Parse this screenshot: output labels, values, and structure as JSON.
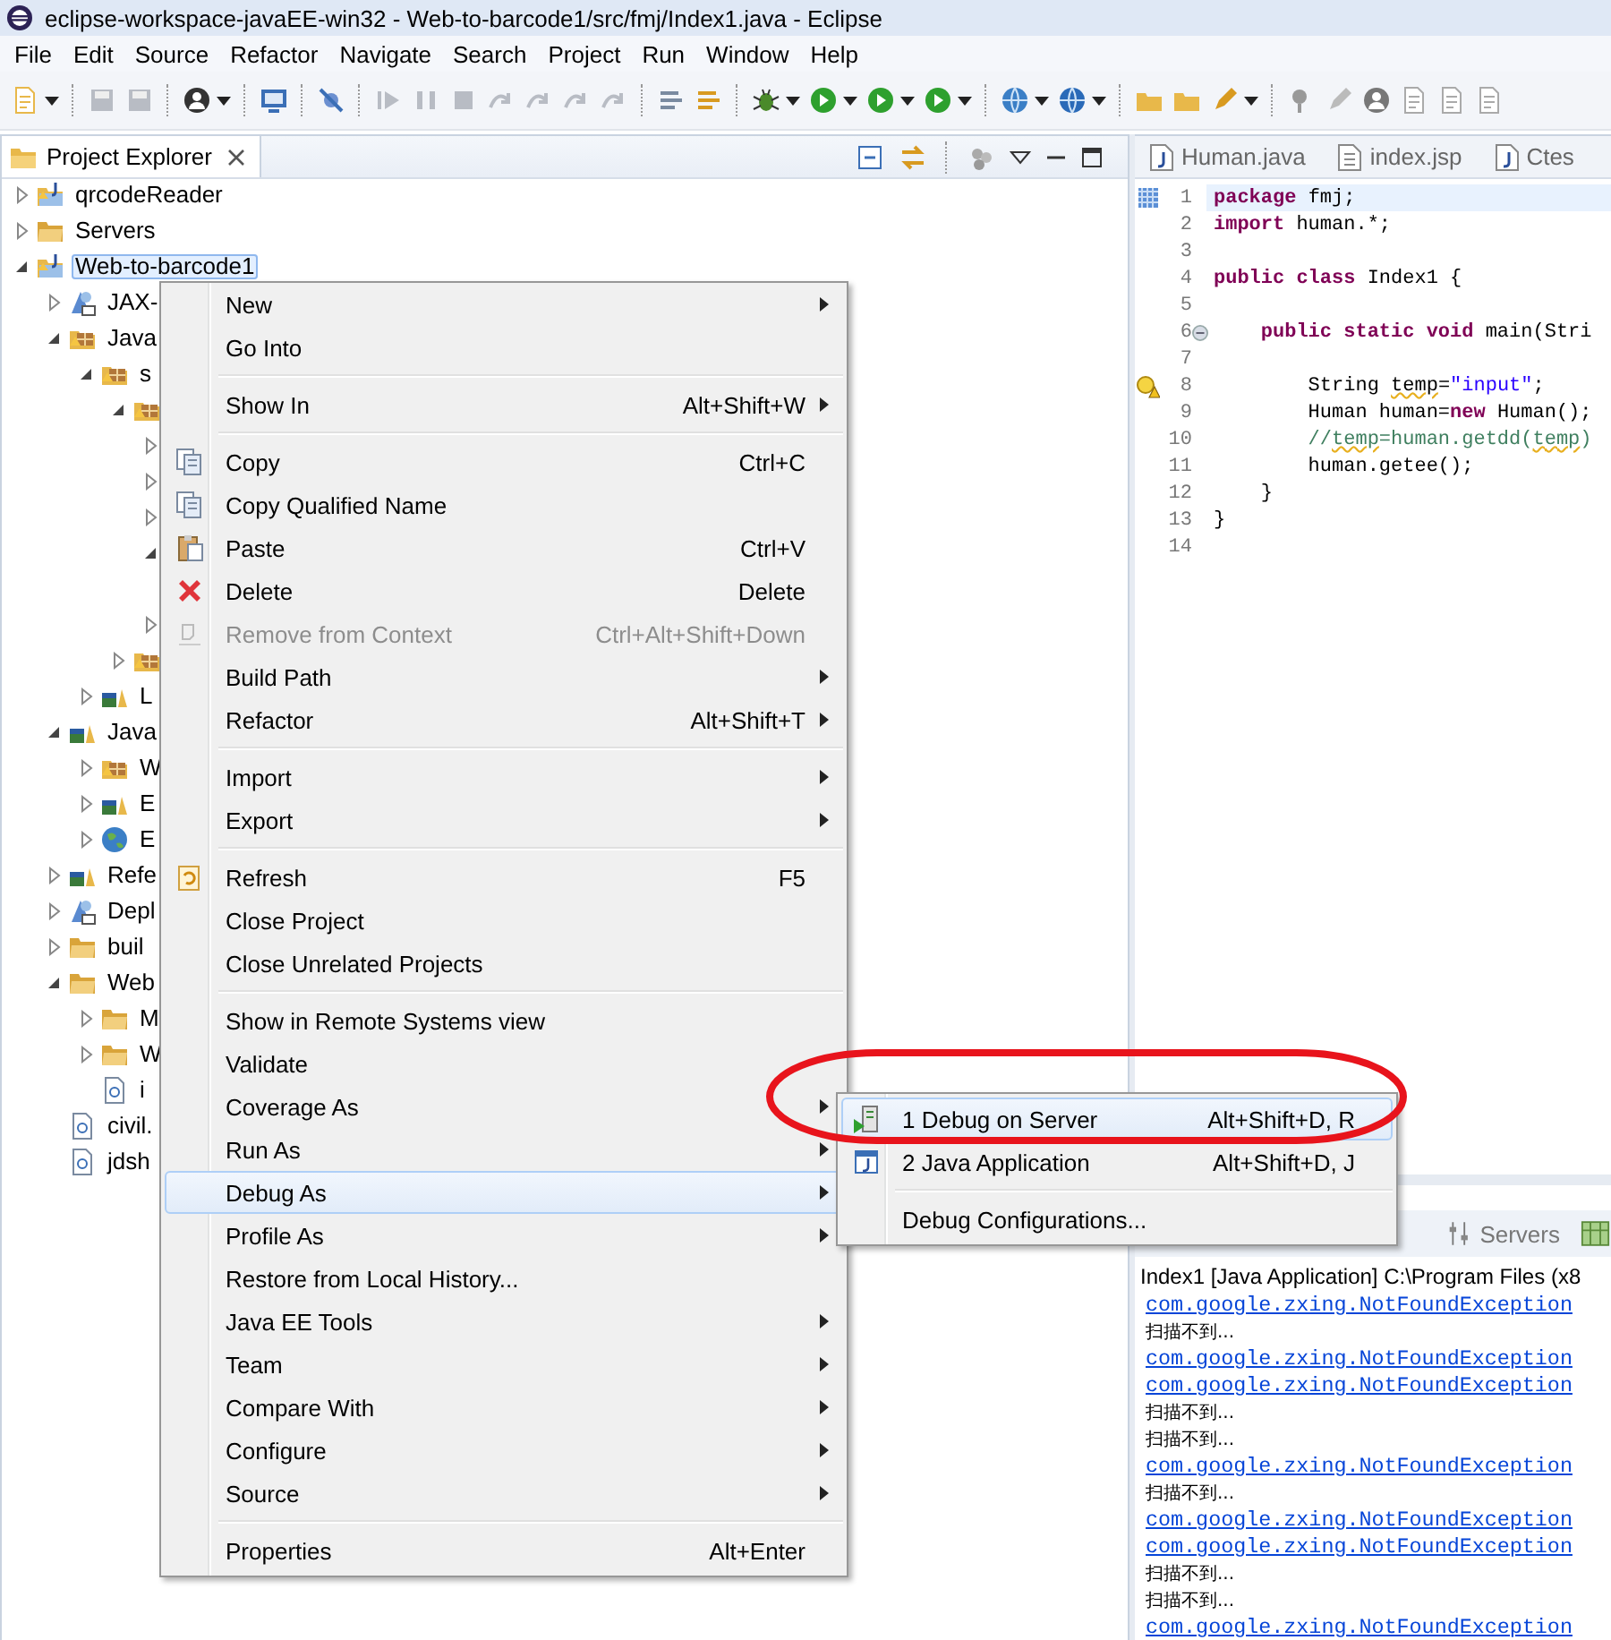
{
  "window": {
    "title": "eclipse-workspace-javaEE-win32 - Web-to-barcode1/src/fmj/Index1.java - Eclipse"
  },
  "menu_bar": [
    "File",
    "Edit",
    "Source",
    "Refactor",
    "Navigate",
    "Search",
    "Project",
    "Run",
    "Window",
    "Help"
  ],
  "project_explorer": {
    "title": "Project Explorer",
    "tree": [
      {
        "label": "qrcodeReader",
        "kind": "project",
        "expanded": false,
        "selected": false
      },
      {
        "label": "Servers",
        "kind": "folder",
        "expanded": false,
        "selected": false
      },
      {
        "label": "Web-to-barcode1",
        "kind": "project",
        "expanded": true,
        "selected": true,
        "children": [
          {
            "label": "JAX-",
            "kind": "service",
            "expanded": false,
            "selected": false
          },
          {
            "label": "Java",
            "kind": "package",
            "expanded": true,
            "selected": false,
            "children": [
              {
                "label": "s",
                "kind": "package",
                "expanded": true,
                "selected": false,
                "children": [
                  {
                    "kind": "package",
                    "expanded": true,
                    "children": [
                      {
                        "expanded": false
                      },
                      {
                        "expanded": false
                      },
                      {
                        "expanded": false
                      },
                      {
                        "expanded": true
                      },
                      {
                        "expanded": false
                      }
                    ]
                  },
                  {
                    "kind": "package",
                    "expanded": false
                  }
                ]
              },
              {
                "label": "L",
                "kind": "library",
                "expanded": false,
                "selected": false
              }
            ]
          },
          {
            "label": "Java",
            "kind": "library",
            "expanded": true,
            "selected": false,
            "children": [
              {
                "label": "W",
                "kind": "package",
                "expanded": false,
                "selected": false
              },
              {
                "label": "E",
                "kind": "library",
                "expanded": false,
                "selected": false
              },
              {
                "label": "E",
                "kind": "globe",
                "expanded": false,
                "selected": false
              }
            ]
          },
          {
            "label": "Refe",
            "kind": "library",
            "expanded": false,
            "selected": false
          },
          {
            "label": "Depl",
            "kind": "service",
            "expanded": false,
            "selected": false
          },
          {
            "label": "buil",
            "kind": "folder",
            "expanded": false,
            "selected": false
          },
          {
            "label": "Web",
            "kind": "folder",
            "expanded": true,
            "selected": false,
            "children": [
              {
                "label": "M",
                "kind": "folder",
                "expanded": false,
                "selected": false
              },
              {
                "label": "W",
                "kind": "folder",
                "expanded": false,
                "selected": false
              },
              {
                "label": "i",
                "kind": "file",
                "selected": false
              }
            ]
          },
          {
            "label": "civil.",
            "kind": "file",
            "selected": false
          },
          {
            "label": "jdsh",
            "kind": "file",
            "selected": false
          }
        ]
      }
    ]
  },
  "editor": {
    "tabs": [
      {
        "label": "Human.java",
        "kind": "java",
        "selected": false
      },
      {
        "label": "index.jsp",
        "kind": "jsp",
        "selected": false
      },
      {
        "label": "Ctes",
        "kind": "java",
        "selected": false
      }
    ],
    "lines": [
      {
        "number": "1",
        "current": true,
        "tokens": [
          {
            "kind": "keyword",
            "text": "package"
          },
          {
            "kind": "plain",
            "text": " fmj;"
          }
        ]
      },
      {
        "number": "2",
        "tokens": [
          {
            "kind": "keyword",
            "text": "import"
          },
          {
            "kind": "plain",
            "text": " human.*;"
          }
        ]
      },
      {
        "number": "3"
      },
      {
        "number": "4",
        "tokens": [
          {
            "kind": "keyword",
            "text": "public class"
          },
          {
            "kind": "plain",
            "text": " Index1 {"
          }
        ]
      },
      {
        "number": "5"
      },
      {
        "number": "6",
        "fold": true,
        "tokens": [
          {
            "kind": "keyword",
            "text": "    public static void"
          },
          {
            "kind": "plain",
            "text": " main(Stri"
          }
        ]
      },
      {
        "number": "7"
      },
      {
        "number": "8",
        "warning": true,
        "tokens": [
          {
            "kind": "plain",
            "text": "        String "
          },
          {
            "kind": "plain",
            "text": "temp",
            "warning": true
          },
          {
            "kind": "plain",
            "text": "="
          },
          {
            "kind": "string",
            "text": "\"input\""
          },
          {
            "kind": "plain",
            "text": ";"
          }
        ]
      },
      {
        "number": "9",
        "tokens": [
          {
            "kind": "plain",
            "text": "        Human human="
          },
          {
            "kind": "keyword",
            "text": "new"
          },
          {
            "kind": "plain",
            "text": " Human();"
          }
        ]
      },
      {
        "number": "10",
        "tokens": [
          {
            "kind": "comment",
            "text": "        //"
          },
          {
            "kind": "comment",
            "text": "temp",
            "warning": true
          },
          {
            "kind": "comment",
            "text": "=human.getdd("
          },
          {
            "kind": "comment",
            "text": "temp",
            "warning": true
          },
          {
            "kind": "comment",
            "text": ")"
          }
        ]
      },
      {
        "number": "11",
        "tokens": [
          {
            "kind": "plain",
            "text": "        human.getee();"
          }
        ]
      },
      {
        "number": "12",
        "tokens": [
          {
            "kind": "plain",
            "text": "    }"
          }
        ]
      },
      {
        "number": "13",
        "tokens": [
          {
            "kind": "plain",
            "text": "}"
          }
        ]
      },
      {
        "number": "14"
      }
    ]
  },
  "console": {
    "tabs": [
      {
        "label": "Servers"
      }
    ],
    "header": "Index1 [Java Application] C:\\Program Files (x8",
    "lines": [
      {
        "kind": "link",
        "text": "com.google.zxing.NotFoundException"
      },
      {
        "kind": "text",
        "text": "扫描不到..."
      },
      {
        "kind": "link",
        "text": "com.google.zxing.NotFoundException"
      },
      {
        "kind": "link",
        "text": "com.google.zxing.NotFoundException"
      },
      {
        "kind": "text",
        "text": "扫描不到..."
      },
      {
        "kind": "text",
        "text": "扫描不到..."
      },
      {
        "kind": "link",
        "text": "com.google.zxing.NotFoundException"
      },
      {
        "kind": "text",
        "text": "扫描不到..."
      },
      {
        "kind": "link",
        "text": "com.google.zxing.NotFoundException"
      },
      {
        "kind": "link",
        "text": "com.google.zxing.NotFoundException"
      },
      {
        "kind": "text",
        "text": "扫描不到..."
      },
      {
        "kind": "text",
        "text": "扫描不到..."
      },
      {
        "kind": "link",
        "text": "com.google.zxing.NotFoundException"
      }
    ]
  },
  "context_menu": {
    "items": [
      {
        "kind": "item",
        "label": "New",
        "submenu": true,
        "selected": false,
        "disabled": false
      },
      {
        "kind": "item",
        "label": "Go Into",
        "submenu": false,
        "selected": false,
        "disabled": false
      },
      {
        "kind": "separator"
      },
      {
        "kind": "item",
        "label": "Show In",
        "shortcut": "Alt+Shift+W",
        "submenu": true,
        "selected": false,
        "disabled": false
      },
      {
        "kind": "separator"
      },
      {
        "kind": "item",
        "label": "Copy",
        "shortcut": "Ctrl+C",
        "submenu": false,
        "selected": false,
        "disabled": false
      },
      {
        "kind": "item",
        "label": "Copy Qualified Name",
        "submenu": false,
        "selected": false,
        "disabled": false
      },
      {
        "kind": "item",
        "label": "Paste",
        "shortcut": "Ctrl+V",
        "submenu": false,
        "selected": false,
        "disabled": false
      },
      {
        "kind": "item",
        "label": "Delete",
        "shortcut": "Delete",
        "submenu": false,
        "selected": false,
        "disabled": false
      },
      {
        "kind": "item",
        "label": "Remove from Context",
        "shortcut": "Ctrl+Alt+Shift+Down",
        "submenu": false,
        "selected": false,
        "disabled": true
      },
      {
        "kind": "item",
        "label": "Build Path",
        "submenu": true,
        "selected": false,
        "disabled": false
      },
      {
        "kind": "item",
        "label": "Refactor",
        "shortcut": "Alt+Shift+T",
        "submenu": true,
        "selected": false,
        "disabled": false
      },
      {
        "kind": "separator"
      },
      {
        "kind": "item",
        "label": "Import",
        "submenu": true,
        "selected": false,
        "disabled": false
      },
      {
        "kind": "item",
        "label": "Export",
        "submenu": true,
        "selected": false,
        "disabled": false
      },
      {
        "kind": "separator"
      },
      {
        "kind": "item",
        "label": "Refresh",
        "shortcut": "F5",
        "submenu": false,
        "selected": false,
        "disabled": false
      },
      {
        "kind": "item",
        "label": "Close Project",
        "submenu": false,
        "selected": false,
        "disabled": false
      },
      {
        "kind": "item",
        "label": "Close Unrelated Projects",
        "submenu": false,
        "selected": false,
        "disabled": false
      },
      {
        "kind": "separator"
      },
      {
        "kind": "item",
        "label": "Show in Remote Systems view",
        "submenu": false,
        "selected": false,
        "disabled": false
      },
      {
        "kind": "item",
        "label": "Validate",
        "submenu": false,
        "selected": false,
        "disabled": false
      },
      {
        "kind": "item",
        "label": "Coverage As",
        "submenu": true,
        "selected": false,
        "disabled": false
      },
      {
        "kind": "item",
        "label": "Run As",
        "submenu": true,
        "selected": false,
        "disabled": false
      },
      {
        "kind": "item",
        "label": "Debug As",
        "submenu": true,
        "selected": true,
        "disabled": false
      },
      {
        "kind": "item",
        "label": "Profile As",
        "submenu": true,
        "selected": false,
        "disabled": false
      },
      {
        "kind": "item",
        "label": "Restore from Local History...",
        "submenu": false,
        "selected": false,
        "disabled": false
      },
      {
        "kind": "item",
        "label": "Java EE Tools",
        "submenu": true,
        "selected": false,
        "disabled": false
      },
      {
        "kind": "item",
        "label": "Team",
        "submenu": true,
        "selected": false,
        "disabled": false
      },
      {
        "kind": "item",
        "label": "Compare With",
        "submenu": true,
        "selected": false,
        "disabled": false
      },
      {
        "kind": "item",
        "label": "Configure",
        "submenu": true,
        "selected": false,
        "disabled": false
      },
      {
        "kind": "item",
        "label": "Source",
        "submenu": true,
        "selected": false,
        "disabled": false
      },
      {
        "kind": "separator"
      },
      {
        "kind": "item",
        "label": "Properties",
        "shortcut": "Alt+Enter",
        "submenu": false,
        "selected": false,
        "disabled": false
      }
    ]
  },
  "submenu": {
    "items": [
      {
        "kind": "item",
        "label": "1 Debug on Server",
        "shortcut": "Alt+Shift+D, R",
        "selected": true
      },
      {
        "kind": "item",
        "label": "2 Java Application",
        "shortcut": "Alt+Shift+D, J",
        "selected": false
      },
      {
        "kind": "separator"
      },
      {
        "kind": "item",
        "label": "Debug Configurations...",
        "selected": false
      }
    ]
  }
}
